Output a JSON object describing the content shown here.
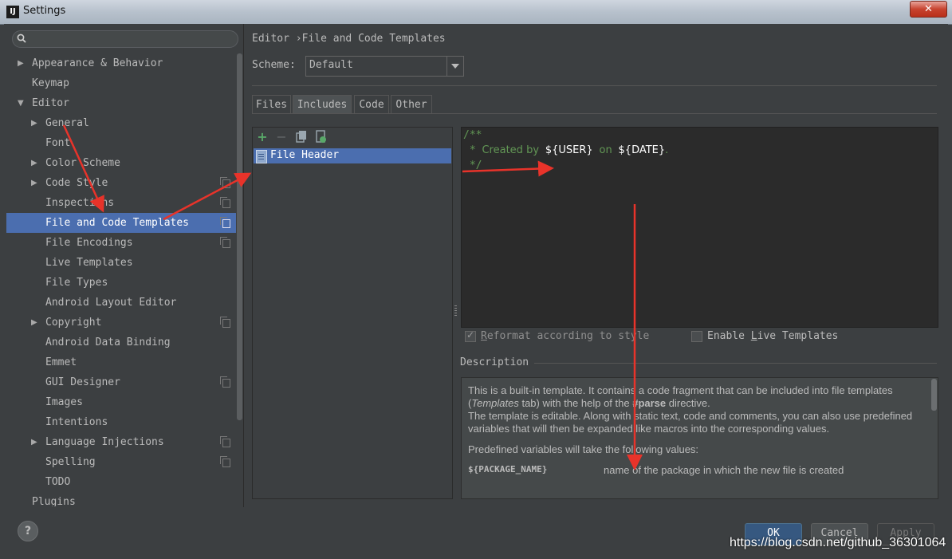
{
  "window": {
    "title": "Settings",
    "app_icon_text": "IJ",
    "close_glyph": "✕"
  },
  "sidebar": {
    "search_placeholder": "",
    "items": [
      {
        "label": "Appearance & Behavior",
        "level": 0,
        "arrow": "right",
        "copy": false
      },
      {
        "label": "Keymap",
        "level": 0,
        "arrow": "none",
        "copy": false
      },
      {
        "label": "Editor",
        "level": 0,
        "arrow": "down",
        "copy": false
      },
      {
        "label": "General",
        "level": 1,
        "arrow": "right",
        "copy": false
      },
      {
        "label": "Font",
        "level": 1,
        "arrow": "none",
        "copy": false
      },
      {
        "label": "Color Scheme",
        "level": 1,
        "arrow": "right",
        "copy": false
      },
      {
        "label": "Code Style",
        "level": 1,
        "arrow": "right",
        "copy": true
      },
      {
        "label": "Inspections",
        "level": 1,
        "arrow": "none",
        "copy": true
      },
      {
        "label": "File and Code Templates",
        "level": 1,
        "arrow": "none",
        "copy": true,
        "selected": true
      },
      {
        "label": "File Encodings",
        "level": 1,
        "arrow": "none",
        "copy": true
      },
      {
        "label": "Live Templates",
        "level": 1,
        "arrow": "none",
        "copy": false
      },
      {
        "label": "File Types",
        "level": 1,
        "arrow": "none",
        "copy": false
      },
      {
        "label": "Android Layout Editor",
        "level": 1,
        "arrow": "none",
        "copy": false
      },
      {
        "label": "Copyright",
        "level": 1,
        "arrow": "right",
        "copy": true
      },
      {
        "label": "Android Data Binding",
        "level": 1,
        "arrow": "none",
        "copy": false
      },
      {
        "label": "Emmet",
        "level": 1,
        "arrow": "none",
        "copy": false
      },
      {
        "label": "GUI Designer",
        "level": 1,
        "arrow": "none",
        "copy": true
      },
      {
        "label": "Images",
        "level": 1,
        "arrow": "none",
        "copy": false
      },
      {
        "label": "Intentions",
        "level": 1,
        "arrow": "none",
        "copy": false
      },
      {
        "label": "Language Injections",
        "level": 1,
        "arrow": "right",
        "copy": true
      },
      {
        "label": "Spelling",
        "level": 1,
        "arrow": "none",
        "copy": true
      },
      {
        "label": "TODO",
        "level": 1,
        "arrow": "none",
        "copy": false
      },
      {
        "label": "Plugins",
        "level": 0,
        "arrow": "none",
        "copy": false
      }
    ]
  },
  "header": {
    "breadcrumb_parent": "Editor",
    "breadcrumb_sep": "›",
    "breadcrumb_current": "File and Code Templates"
  },
  "scheme": {
    "label": "Scheme:",
    "value": "Default"
  },
  "tabs": [
    {
      "label": "Files",
      "active": false
    },
    {
      "label": "Includes",
      "active": true
    },
    {
      "label": "Code",
      "active": false
    },
    {
      "label": "Other",
      "active": false
    }
  ],
  "toolbar": {
    "add_glyph": "+",
    "remove_glyph": "−"
  },
  "template_list": {
    "items": [
      "File Header"
    ]
  },
  "editor": {
    "line1": "/**",
    "line2_prefix": " * ",
    "line2_created": "Created by",
    "line2_user": "${USER}",
    "line2_on": "on",
    "line2_date": "${DATE}",
    "line2_end": ".",
    "line3": " */"
  },
  "options": {
    "reformat_pre": "R",
    "reformat_post": "eformat according to style",
    "reformat_checked": true,
    "live_pre": "Enable ",
    "live_u": "L",
    "live_post": "ive Templates",
    "live_checked": false
  },
  "description": {
    "title": "Description",
    "p1_a": "This is a built-in template. It contains a code fragment that can be included into file templates (",
    "p1_templates": "Templates",
    "p1_b": " tab) with the help of the ",
    "p1_parse": "#parse",
    "p1_c": " directive.",
    "p1_d": "The template is editable. Along with static text, code and comments, you can also use predefined variables that will then be expanded like macros into the corresponding values.",
    "p2": "Predefined variables will take the following values:",
    "var_name": "${PACKAGE_NAME}",
    "var_desc": "name of the package in which the new file is created"
  },
  "buttons": {
    "help": "?",
    "ok": "OK",
    "cancel": "Cancel",
    "apply": "Apply"
  },
  "watermark": "https://blog.csdn.net/github_36301064",
  "colors": {
    "accent_selection": "#4b6eaf",
    "annotation_arrow": "#e8332a"
  }
}
